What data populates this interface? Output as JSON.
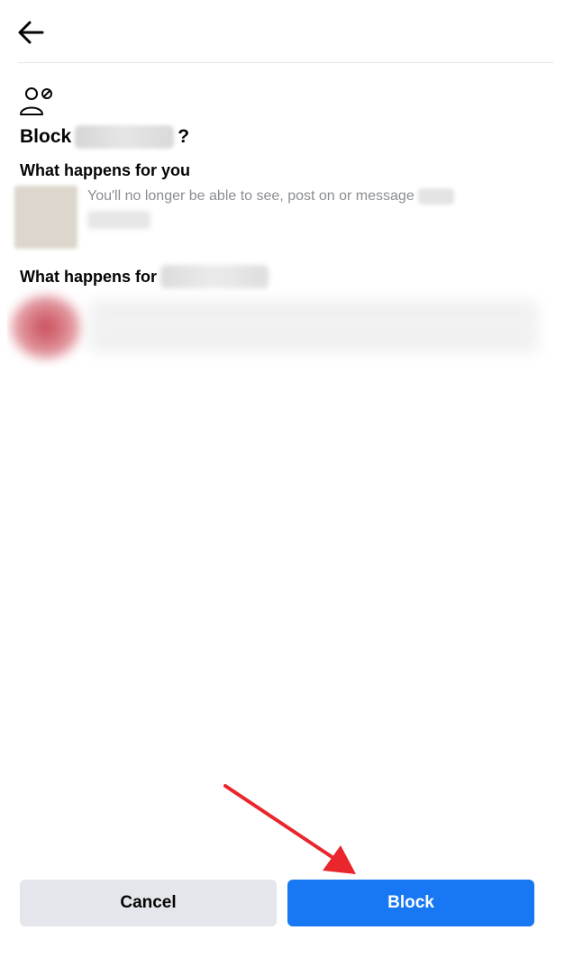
{
  "header": {
    "back_icon": "arrow-left-icon"
  },
  "dialog": {
    "icon": "block-user-icon",
    "title_prefix": "Block",
    "title_suffix": "?",
    "you_section": {
      "heading": "What happens for you",
      "description": "You'll no longer be able to see, post on or message"
    },
    "them_section": {
      "heading": "What happens for"
    }
  },
  "actions": {
    "cancel_label": "Cancel",
    "block_label": "Block"
  },
  "colors": {
    "primary": "#1877f2",
    "secondary_button": "#e4e6eb",
    "annotation_arrow": "#e8262c"
  }
}
